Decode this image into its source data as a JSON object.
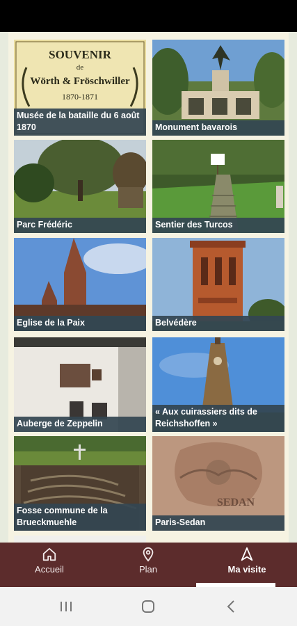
{
  "cards": [
    {
      "caption": "Musée de la bataille du 6 août 1870",
      "image_text": {
        "line1": "SOUVENIR",
        "line2": "de",
        "line3": "Wörth & Fröschwiller",
        "line4": "1870-1871"
      }
    },
    {
      "caption": "Monument bavarois"
    },
    {
      "caption": "Parc Frédéric"
    },
    {
      "caption": "Sentier des Turcos"
    },
    {
      "caption": "Eglise de la Paix"
    },
    {
      "caption": "Belvédère"
    },
    {
      "caption": "Auberge de Zeppelin"
    },
    {
      "caption": "« Aux cuirassiers dits de Reichshoffen »"
    },
    {
      "caption": "Fosse commune de la Brueckmuehle"
    },
    {
      "caption": "Paris-Sedan",
      "image_text": "SEDAN"
    }
  ],
  "bottom_nav": {
    "items": [
      {
        "label": "Accueil",
        "icon": "home-icon"
      },
      {
        "label": "Plan",
        "icon": "map-pin-icon"
      },
      {
        "label": "Ma visite",
        "icon": "navigation-arrow-icon",
        "active": true
      }
    ],
    "background": "#5c2c2c"
  },
  "system_nav": {
    "buttons": [
      "recent-apps-icon",
      "home-circle-icon",
      "back-icon"
    ]
  },
  "colors": {
    "caption_background": "#344652",
    "page_background": "#e7ebde"
  }
}
